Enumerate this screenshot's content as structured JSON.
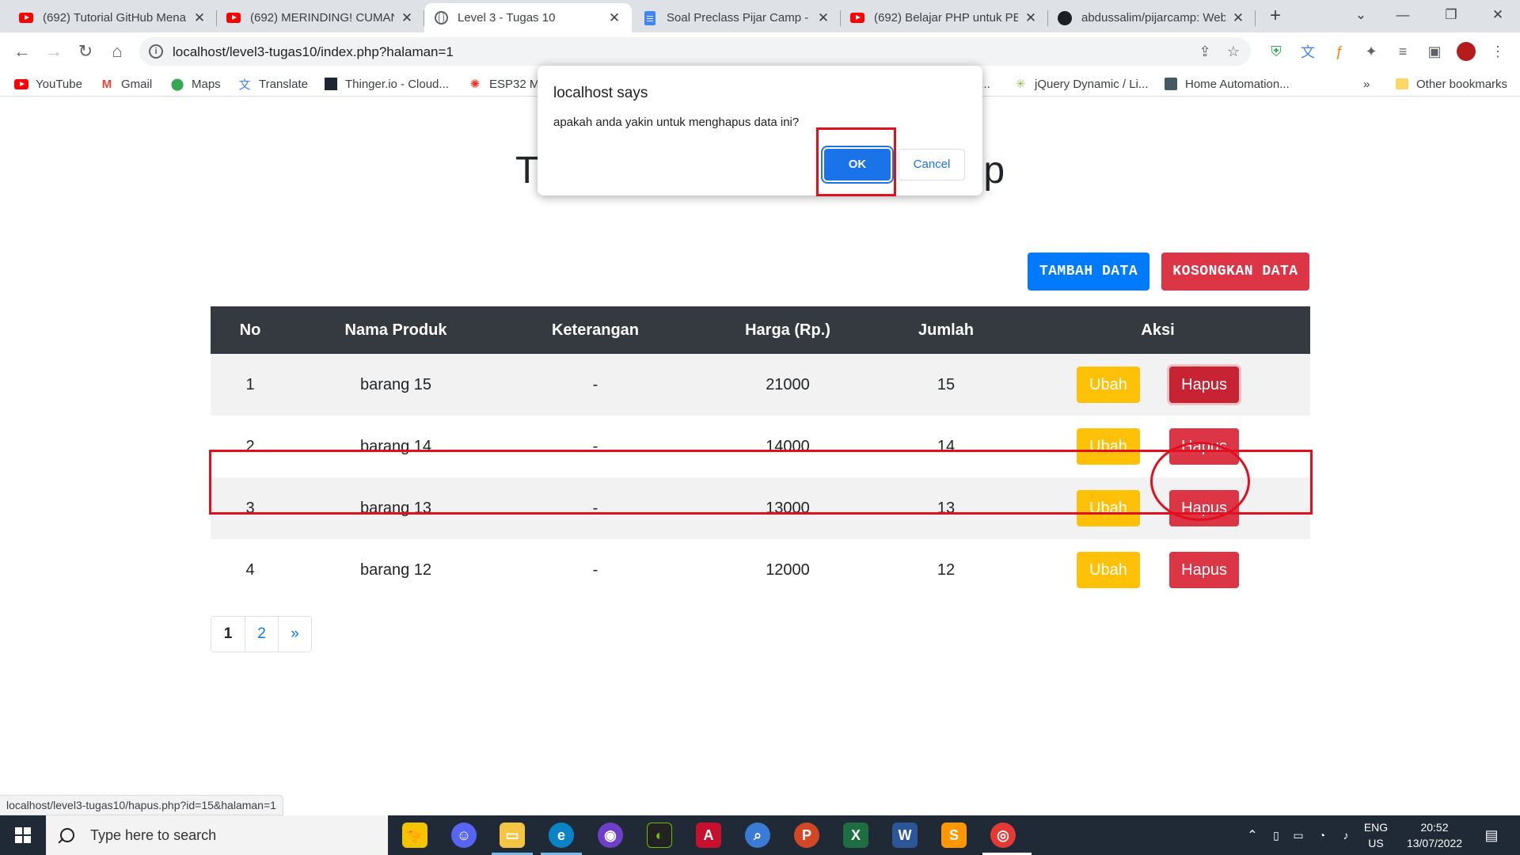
{
  "browser": {
    "tabs": [
      {
        "title": "(692) Tutorial GitHub Mena",
        "icon": "youtube-icon"
      },
      {
        "title": "(692) MERINDING! CUMAN",
        "icon": "youtube-icon"
      },
      {
        "title": "Level 3 - Tugas 10",
        "icon": "globe-icon",
        "active": true
      },
      {
        "title": "Soal Preclass Pijar Camp - G",
        "icon": "docs-icon"
      },
      {
        "title": "(692) Belajar PHP untuk PE",
        "icon": "youtube-icon"
      },
      {
        "title": "abdussalim/pijarcamp: Web",
        "icon": "github-icon"
      }
    ],
    "address": "localhost/level3-tugas10/index.php?halaman=1",
    "bookmarks": [
      {
        "label": "YouTube",
        "icon": "youtube-icon"
      },
      {
        "label": "Gmail",
        "icon": "gmail-icon"
      },
      {
        "label": "Maps",
        "icon": "maps-icon"
      },
      {
        "label": "Translate",
        "icon": "translate-icon"
      },
      {
        "label": "Thinger.io - Cloud...",
        "icon": "thinger-icon"
      },
      {
        "label": "ESP32 M",
        "icon": "esp32-icon"
      },
      {
        "label": "e...",
        "icon": ""
      },
      {
        "label": "jQuery Dynamic / Li...",
        "icon": "jquery-icon"
      },
      {
        "label": "Home Automation...",
        "icon": "home-automation-icon"
      },
      {
        "label": "»",
        "icon": ""
      },
      {
        "label": "Other bookmarks",
        "icon": "folder-icon"
      }
    ],
    "status_url": "localhost/level3-tugas10/hapus.php?id=15&halaman=1"
  },
  "page": {
    "title_left": "T",
    "title_right": "p",
    "add_button": "TAMBAH DATA",
    "clear_button": "KOSONGKAN DATA",
    "columns": [
      "No",
      "Nama Produk",
      "Keterangan",
      "Harga (Rp.)",
      "Jumlah",
      "Aksi"
    ],
    "rows": [
      {
        "no": "1",
        "nama": "barang 15",
        "ket": "-",
        "harga": "21000",
        "jumlah": "15",
        "edit": "Ubah",
        "delete": "Hapus"
      },
      {
        "no": "2",
        "nama": "barang 14",
        "ket": "-",
        "harga": "14000",
        "jumlah": "14",
        "edit": "Ubah",
        "delete": "Hapus"
      },
      {
        "no": "3",
        "nama": "barang 13",
        "ket": "-",
        "harga": "13000",
        "jumlah": "13",
        "edit": "Ubah",
        "delete": "Hapus"
      },
      {
        "no": "4",
        "nama": "barang 12",
        "ket": "-",
        "harga": "12000",
        "jumlah": "12",
        "edit": "Ubah",
        "delete": "Hapus"
      }
    ],
    "pagination": [
      "1",
      "2",
      "»"
    ],
    "colors": {
      "primary": "#007bff",
      "danger": "#dc3545",
      "warning": "#ffc107",
      "header": "#343a40"
    }
  },
  "dialog": {
    "title": "localhost says",
    "message": "apakah anda yakin untuk menghapus data ini?",
    "ok": "OK",
    "cancel": "Cancel"
  },
  "taskbar": {
    "search_placeholder": "Type here to search",
    "lang_top": "ENG",
    "lang_bottom": "US",
    "time": "20:52",
    "date": "13/07/2022"
  }
}
